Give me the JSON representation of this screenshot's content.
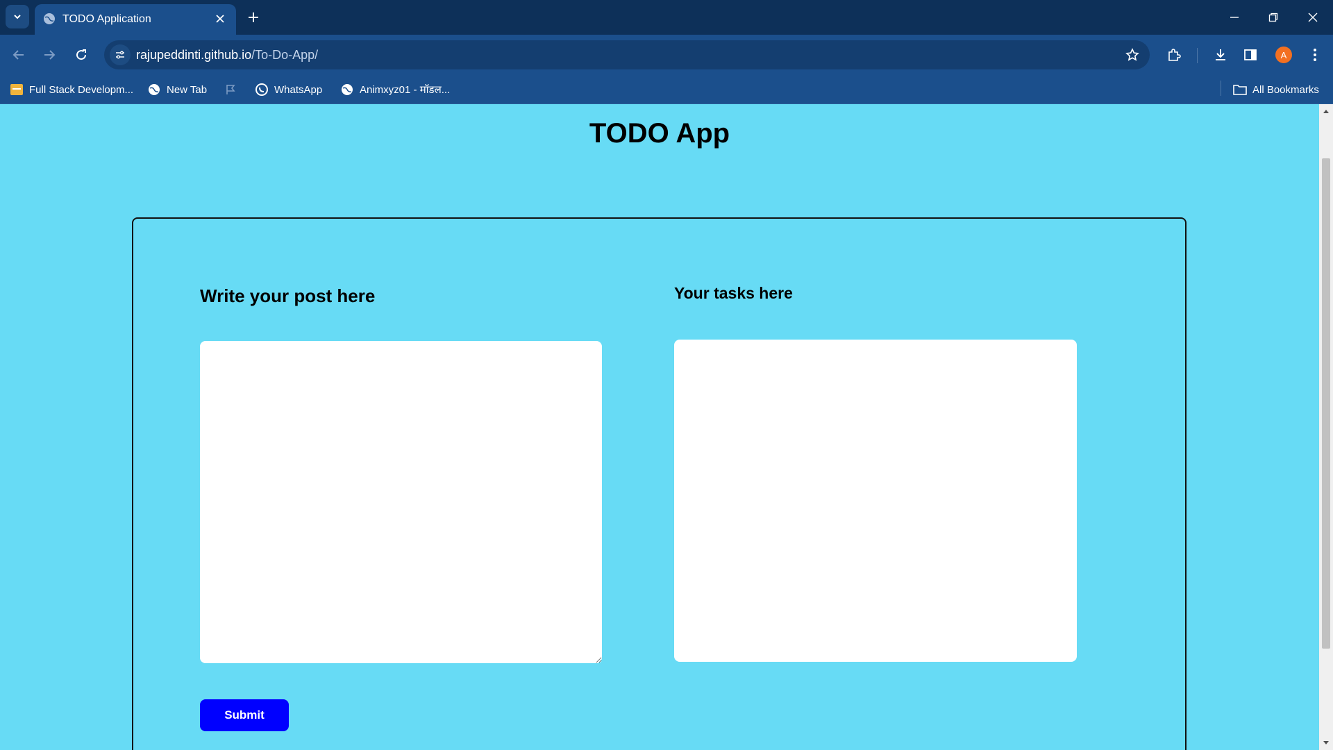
{
  "browser": {
    "tab_title": "TODO Application",
    "url_host": "rajupeddinti.github.io",
    "url_path": "/To-Do-App/",
    "profile_initial": "A",
    "bookmarks": [
      {
        "label": "Full Stack Developm...",
        "icon": "folder-bookmark-icon"
      },
      {
        "label": "New Tab",
        "icon": "globe-icon"
      },
      {
        "label": "",
        "icon": "flag-icon"
      },
      {
        "label": "WhatsApp",
        "icon": "whatsapp-icon"
      },
      {
        "label": "Animxyz01 - मॉडल...",
        "icon": "globe-icon"
      }
    ],
    "all_bookmarks_label": "All Bookmarks"
  },
  "page": {
    "title": "TODO App",
    "left_heading": "Write your post here",
    "right_heading": "Your tasks here",
    "post_input_value": "",
    "submit_label": "Submit"
  },
  "colors": {
    "page_background": "#67dbf5",
    "submit_button": "#0000ff",
    "chrome_dark": "#0d3059",
    "chrome_toolbar": "#1b4f8c"
  }
}
